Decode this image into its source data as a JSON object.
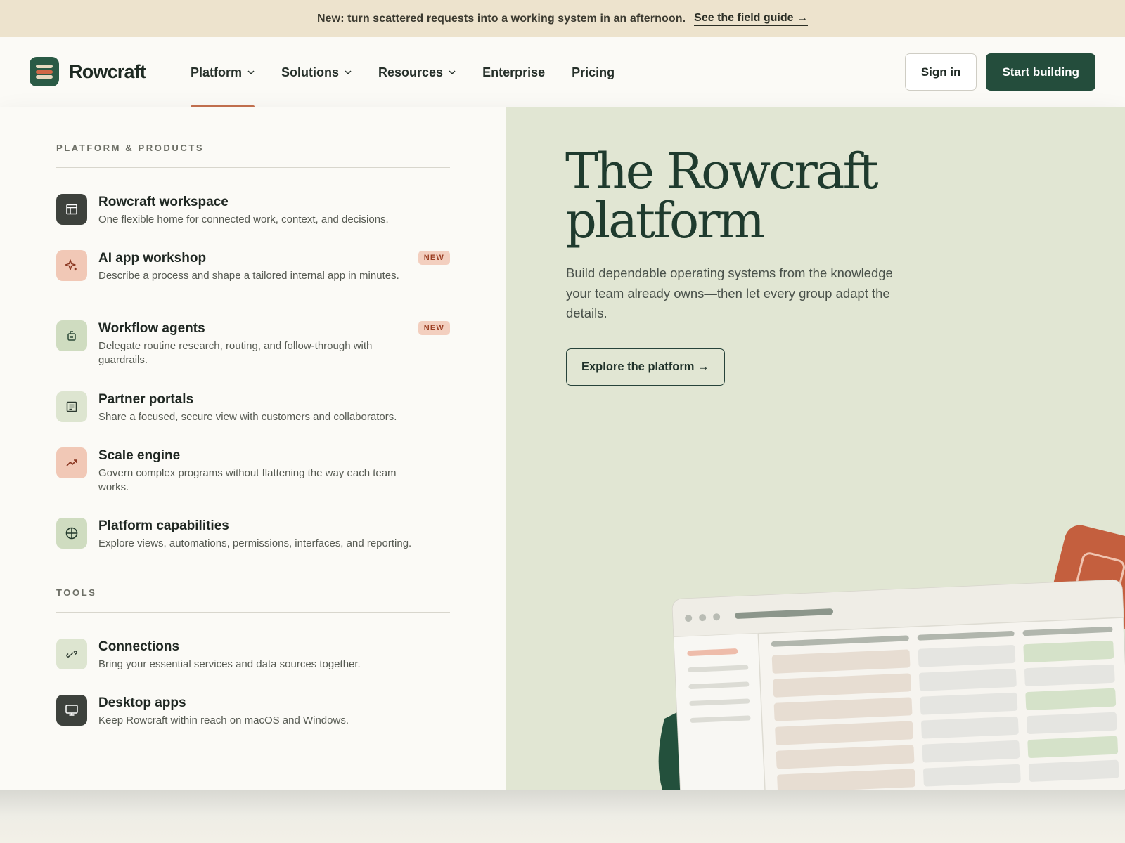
{
  "announcement": {
    "message": "New: turn scattered requests into a working system in an afternoon.",
    "link": "See the field guide →"
  },
  "brand": {
    "name": "Rowcraft"
  },
  "nav": {
    "items": [
      {
        "label": "Platform",
        "has_dropdown": true,
        "active": true
      },
      {
        "label": "Solutions",
        "has_dropdown": true
      },
      {
        "label": "Resources",
        "has_dropdown": true
      },
      {
        "label": "Enterprise",
        "has_dropdown": false
      },
      {
        "label": "Pricing",
        "has_dropdown": false
      }
    ],
    "sign_in": "Sign in",
    "cta": "Start building"
  },
  "dropdown": {
    "sections": [
      {
        "label": "PLATFORM & PRODUCTS",
        "items": [
          {
            "title": "Rowcraft workspace",
            "desc": "One flexible home for connected work, context, and decisions.",
            "icon": "layout-icon",
            "tone": "dark"
          },
          {
            "title": "AI app workshop",
            "desc": "Describe a process and shape a tailored internal app in minutes.",
            "icon": "sparkle-icon",
            "tone": "peach",
            "badge": "NEW"
          },
          {
            "title": "Workflow agents",
            "desc": "Delegate routine research, routing, and follow-through with guardrails.",
            "icon": "agent-icon",
            "tone": "sage",
            "badge": "NEW"
          },
          {
            "title": "Partner portals",
            "desc": "Share a focused, secure view with customers and collaborators.",
            "icon": "portal-icon",
            "tone": "sage-light"
          },
          {
            "title": "Scale engine",
            "desc": "Govern complex programs without flattening the way each team works.",
            "icon": "trend-up-icon",
            "tone": "peach"
          },
          {
            "title": "Platform capabilities",
            "desc": "Explore views, automations, permissions, interfaces, and reporting.",
            "icon": "globe-grid-icon",
            "tone": "sage"
          }
        ]
      },
      {
        "label": "TOOLS",
        "items": [
          {
            "title": "Connections",
            "desc": "Bring your essential services and data sources together.",
            "icon": "link-icon",
            "tone": "sage-light"
          },
          {
            "title": "Desktop apps",
            "desc": "Keep Rowcraft within reach on macOS and Windows.",
            "icon": "monitor-icon",
            "tone": "dark"
          }
        ]
      }
    ]
  },
  "hero": {
    "title_line1": "The Rowcraft",
    "title_line2": "platform",
    "subtitle": "Build dependable operating systems from the knowledge your team already owns—then let every group adapt the details.",
    "cta": "Explore the platform →"
  },
  "colors": {
    "announce_bg": "#ede3cd",
    "brand_green": "#244d3c",
    "accent_orange": "#c4714f",
    "hero_bg": "#e1e6d3",
    "badge_bg": "#f3cfbf"
  }
}
